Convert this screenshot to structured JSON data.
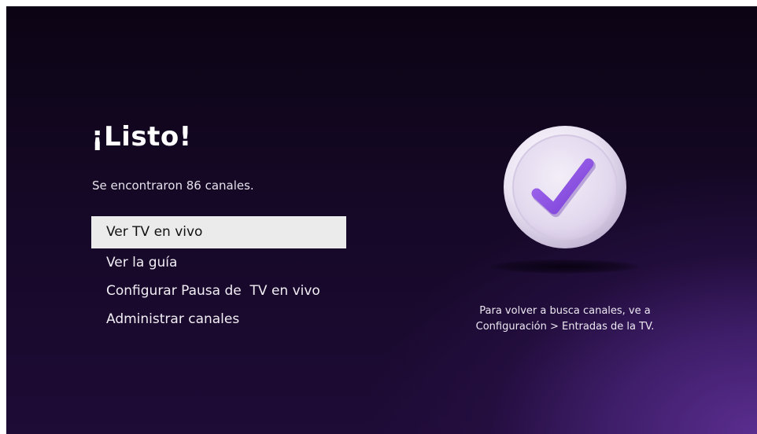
{
  "screen": {
    "title": "¡Listo!",
    "subtitle": "Se encontraron 86 canales.",
    "menu": {
      "items": [
        {
          "label": "Ver TV en vivo",
          "selected": true
        },
        {
          "label": "Ver la guía",
          "selected": false
        },
        {
          "label": "Configurar Pausa de  TV en vivo",
          "selected": false
        },
        {
          "label": "Administrar canales",
          "selected": false
        }
      ]
    },
    "info": {
      "line1": "Para volver a busca canales, ve a",
      "line2": "Configuración > Entradas de la TV."
    },
    "badge_icon": "checkmark-badge-icon"
  },
  "colors": {
    "accent_purple": "#8a4ee0",
    "highlight": "#ecebec"
  }
}
